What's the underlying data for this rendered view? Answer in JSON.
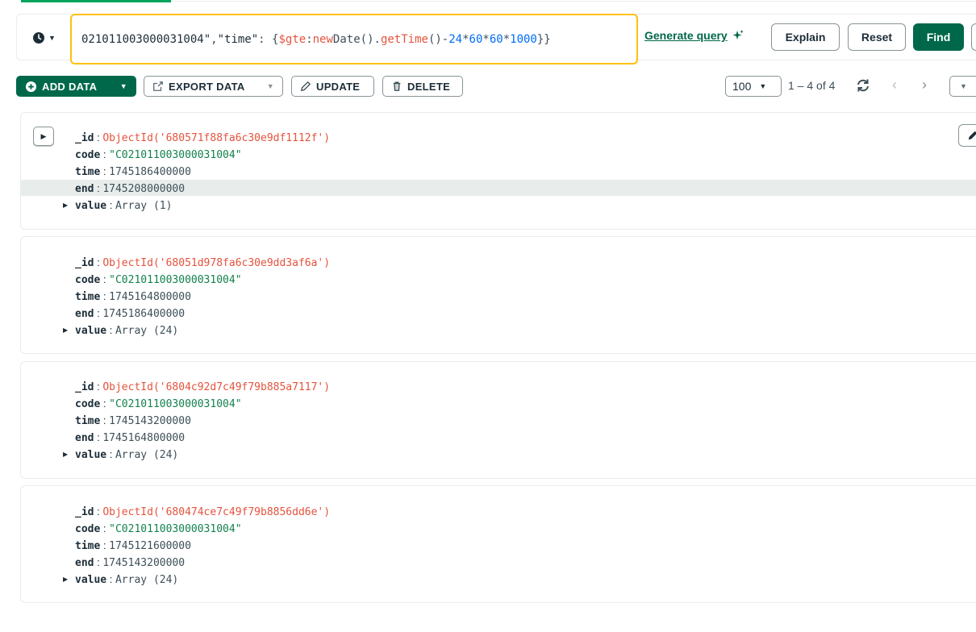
{
  "query": {
    "str_tail": "021011003000031004\"",
    "comma": ",",
    "key": "\"time\"",
    "colon": ": {",
    "op": "$gte",
    "colon2": ": ",
    "kw": "new",
    "ident": " Date().",
    "func": "getTime",
    "paren": "()-",
    "n1": "24",
    "m1": "*",
    "n2": "60",
    "m2": "*",
    "n3": "60",
    "m3": "*",
    "n4": "1000",
    "close": "}}"
  },
  "querybar": {
    "generate_label": "Generate query",
    "explain_label": "Explain",
    "reset_label": "Reset",
    "find_label": "Find"
  },
  "toolbar": {
    "add_label": "ADD DATA",
    "export_label": "EXPORT DATA",
    "update_label": "UPDATE",
    "delete_label": "DELETE",
    "page_size": "100",
    "range": "1 – 4 of 4"
  },
  "labels": {
    "id": "_id",
    "code": "code",
    "time": "time",
    "end": "end",
    "value": "value",
    "sep": " : "
  },
  "documents": [
    {
      "id": "ObjectId('680571f88fa6c30e9df1112f')",
      "code": "\"C021011003000031004\"",
      "time": "1745186400000",
      "end": "1745208000000",
      "value": "Array (1)"
    },
    {
      "id": "ObjectId('68051d978fa6c30e9dd3af6a')",
      "code": "\"C021011003000031004\"",
      "time": "1745164800000",
      "end": "1745186400000",
      "value": "Array (24)"
    },
    {
      "id": "ObjectId('6804c92d7c49f79b885a7117')",
      "code": "\"C021011003000031004\"",
      "time": "1745143200000",
      "end": "1745164800000",
      "value": "Array (24)"
    },
    {
      "id": "ObjectId('680474ce7c49f79b8856dd6e')",
      "code": "\"C021011003000031004\"",
      "time": "1745121600000",
      "end": "1745143200000",
      "value": "Array (24)"
    }
  ],
  "icons": {
    "history": "clock-icon",
    "sparkle": "sparkle-icon",
    "add": "plus-circle-icon",
    "export": "export-icon",
    "update": "pencil-icon",
    "delete": "trash-icon",
    "refresh": "refresh-icon",
    "edit": "edit-icon"
  },
  "colors": {
    "brand": "#00684a",
    "highlight_border": "#ffc010",
    "objectid": "#e5533d",
    "string": "#12824d",
    "number": "#016bf8"
  }
}
